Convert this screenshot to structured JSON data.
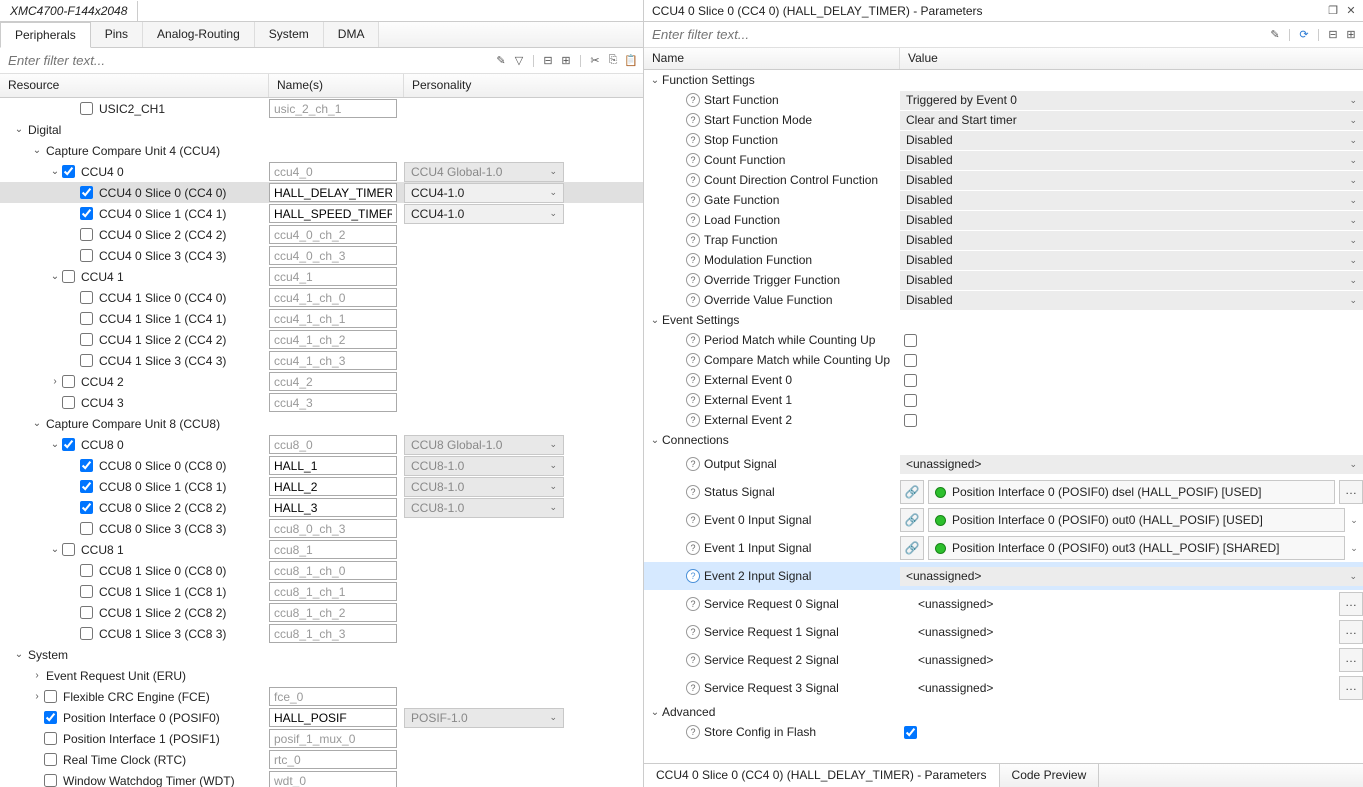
{
  "left": {
    "title_tab": "XMC4700-F144x2048",
    "subtabs": [
      "Peripherals",
      "Pins",
      "Analog-Routing",
      "System",
      "DMA"
    ],
    "active_subtab": 0,
    "filter_placeholder": "Enter filter text...",
    "headers": {
      "resource": "Resource",
      "names": "Name(s)",
      "personality": "Personality"
    },
    "tree": [
      {
        "indent": 3,
        "twisty": "",
        "chk": false,
        "label": "USIC2_CH1",
        "name": "usic_2_ch_1",
        "name_disabled": true,
        "pers": ""
      },
      {
        "indent": 0,
        "twisty": "open",
        "chk": null,
        "label": "Digital"
      },
      {
        "indent": 1,
        "twisty": "open",
        "chk": null,
        "label": "Capture Compare Unit 4 (CCU4)"
      },
      {
        "indent": 2,
        "twisty": "open",
        "chk": true,
        "label": "CCU4 0",
        "name": "ccu4_0",
        "name_disabled": true,
        "pers": "CCU4 Global-1.0",
        "pers_disabled": true
      },
      {
        "indent": 3,
        "twisty": "",
        "chk": true,
        "label": "CCU4 0 Slice 0 (CC4 0)",
        "name": "HALL_DELAY_TIMER",
        "pers": "CCU4-1.0",
        "selected": true
      },
      {
        "indent": 3,
        "twisty": "",
        "chk": true,
        "label": "CCU4 0 Slice 1 (CC4 1)",
        "name": "HALL_SPEED_TIMER",
        "pers": "CCU4-1.0"
      },
      {
        "indent": 3,
        "twisty": "",
        "chk": false,
        "label": "CCU4 0 Slice 2 (CC4 2)",
        "name": "ccu4_0_ch_2",
        "name_disabled": true
      },
      {
        "indent": 3,
        "twisty": "",
        "chk": false,
        "label": "CCU4 0 Slice 3 (CC4 3)",
        "name": "ccu4_0_ch_3",
        "name_disabled": true
      },
      {
        "indent": 2,
        "twisty": "open",
        "chk": false,
        "label": "CCU4 1",
        "name": "ccu4_1",
        "name_disabled": true
      },
      {
        "indent": 3,
        "twisty": "",
        "chk": false,
        "label": "CCU4 1 Slice 0 (CC4 0)",
        "name": "ccu4_1_ch_0",
        "name_disabled": true
      },
      {
        "indent": 3,
        "twisty": "",
        "chk": false,
        "label": "CCU4 1 Slice 1 (CC4 1)",
        "name": "ccu4_1_ch_1",
        "name_disabled": true
      },
      {
        "indent": 3,
        "twisty": "",
        "chk": false,
        "label": "CCU4 1 Slice 2 (CC4 2)",
        "name": "ccu4_1_ch_2",
        "name_disabled": true
      },
      {
        "indent": 3,
        "twisty": "",
        "chk": false,
        "label": "CCU4 1 Slice 3 (CC4 3)",
        "name": "ccu4_1_ch_3",
        "name_disabled": true
      },
      {
        "indent": 2,
        "twisty": "closed",
        "chk": false,
        "label": "CCU4 2",
        "name": "ccu4_2",
        "name_disabled": true
      },
      {
        "indent": 2,
        "twisty": "",
        "chk": false,
        "label": "CCU4 3",
        "name": "ccu4_3",
        "name_disabled": true
      },
      {
        "indent": 1,
        "twisty": "open",
        "chk": null,
        "label": "Capture Compare Unit 8 (CCU8)"
      },
      {
        "indent": 2,
        "twisty": "open",
        "chk": true,
        "label": "CCU8 0",
        "name": "ccu8_0",
        "name_disabled": true,
        "pers": "CCU8 Global-1.0",
        "pers_disabled": true
      },
      {
        "indent": 3,
        "twisty": "",
        "chk": true,
        "label": "CCU8 0 Slice 0 (CC8 0)",
        "name": "HALL_1",
        "pers": "CCU8-1.0",
        "pers_disabled": true
      },
      {
        "indent": 3,
        "twisty": "",
        "chk": true,
        "label": "CCU8 0 Slice 1 (CC8 1)",
        "name": "HALL_2",
        "pers": "CCU8-1.0",
        "pers_disabled": true
      },
      {
        "indent": 3,
        "twisty": "",
        "chk": true,
        "label": "CCU8 0 Slice 2 (CC8 2)",
        "name": "HALL_3",
        "pers": "CCU8-1.0",
        "pers_disabled": true
      },
      {
        "indent": 3,
        "twisty": "",
        "chk": false,
        "label": "CCU8 0 Slice 3 (CC8 3)",
        "name": "ccu8_0_ch_3",
        "name_disabled": true
      },
      {
        "indent": 2,
        "twisty": "open",
        "chk": false,
        "label": "CCU8 1",
        "name": "ccu8_1",
        "name_disabled": true
      },
      {
        "indent": 3,
        "twisty": "",
        "chk": false,
        "label": "CCU8 1 Slice 0 (CC8 0)",
        "name": "ccu8_1_ch_0",
        "name_disabled": true
      },
      {
        "indent": 3,
        "twisty": "",
        "chk": false,
        "label": "CCU8 1 Slice 1 (CC8 1)",
        "name": "ccu8_1_ch_1",
        "name_disabled": true
      },
      {
        "indent": 3,
        "twisty": "",
        "chk": false,
        "label": "CCU8 1 Slice 2 (CC8 2)",
        "name": "ccu8_1_ch_2",
        "name_disabled": true
      },
      {
        "indent": 3,
        "twisty": "",
        "chk": false,
        "label": "CCU8 1 Slice 3 (CC8 3)",
        "name": "ccu8_1_ch_3",
        "name_disabled": true
      },
      {
        "indent": 0,
        "twisty": "open",
        "chk": null,
        "label": "System"
      },
      {
        "indent": 1,
        "twisty": "closed",
        "chk": null,
        "label": "Event Request Unit (ERU)"
      },
      {
        "indent": 1,
        "twisty": "closed",
        "chk": false,
        "label": "Flexible CRC Engine (FCE)",
        "name": "fce_0",
        "name_disabled": true
      },
      {
        "indent": 1,
        "twisty": "",
        "chk": true,
        "label": "Position Interface 0 (POSIF0)",
        "name": "HALL_POSIF",
        "pers": "POSIF-1.0",
        "pers_disabled": true
      },
      {
        "indent": 1,
        "twisty": "",
        "chk": false,
        "label": "Position Interface 1 (POSIF1)",
        "name": "posif_1_mux_0",
        "name_disabled": true
      },
      {
        "indent": 1,
        "twisty": "",
        "chk": false,
        "label": "Real Time Clock (RTC)",
        "name": "rtc_0",
        "name_disabled": true
      },
      {
        "indent": 1,
        "twisty": "",
        "chk": false,
        "label": "Window Watchdog Timer (WDT)",
        "name": "wdt_0",
        "name_disabled": true
      }
    ]
  },
  "right": {
    "title": "CCU4 0 Slice 0 (CC4 0) (HALL_DELAY_TIMER) - Parameters",
    "filter_placeholder": "Enter filter text...",
    "headers": {
      "name": "Name",
      "value": "Value"
    },
    "groups": [
      {
        "label": "Function Settings",
        "rows": [
          {
            "name": "Start Function",
            "type": "dropdown",
            "value": "Triggered by Event 0"
          },
          {
            "name": "Start Function Mode",
            "type": "dropdown",
            "value": "Clear and Start timer"
          },
          {
            "name": "Stop Function",
            "type": "dropdown",
            "value": "Disabled"
          },
          {
            "name": "Count Function",
            "type": "dropdown",
            "value": "Disabled"
          },
          {
            "name": "Count Direction Control Function",
            "type": "dropdown",
            "value": "Disabled"
          },
          {
            "name": "Gate Function",
            "type": "dropdown",
            "value": "Disabled"
          },
          {
            "name": "Load Function",
            "type": "dropdown",
            "value": "Disabled"
          },
          {
            "name": "Trap Function",
            "type": "dropdown",
            "value": "Disabled"
          },
          {
            "name": "Modulation Function",
            "type": "dropdown",
            "value": "Disabled"
          },
          {
            "name": "Override Trigger Function",
            "type": "dropdown",
            "value": "Disabled"
          },
          {
            "name": "Override Value Function",
            "type": "dropdown",
            "value": "Disabled"
          }
        ]
      },
      {
        "label": "Event Settings",
        "rows": [
          {
            "name": "Period Match while Counting Up",
            "type": "checkbox",
            "checked": false
          },
          {
            "name": "Compare Match while Counting Up",
            "type": "checkbox",
            "checked": false
          },
          {
            "name": "External Event 0",
            "type": "checkbox",
            "checked": false
          },
          {
            "name": "External Event 1",
            "type": "checkbox",
            "checked": false
          },
          {
            "name": "External Event 2",
            "type": "checkbox",
            "checked": false
          }
        ]
      },
      {
        "label": "Connections",
        "rows": [
          {
            "name": "Output Signal",
            "type": "sigdrop",
            "value": "<unassigned>"
          },
          {
            "name": "Status Signal",
            "type": "siglink",
            "value": "Position Interface 0 (POSIF0) dsel (HALL_POSIF) [USED]",
            "ellipsis": true
          },
          {
            "name": "Event 0 Input Signal",
            "type": "siglink",
            "value": "Position Interface 0 (POSIF0) out0 (HALL_POSIF) [USED]",
            "dd": true
          },
          {
            "name": "Event 1 Input Signal",
            "type": "siglink",
            "value": "Position Interface 0 (POSIF0) out3 (HALL_POSIF) [SHARED]",
            "dd": true
          },
          {
            "name": "Event 2 Input Signal",
            "type": "sigdrop",
            "value": "<unassigned>",
            "selected": true
          },
          {
            "name": "Service Request 0 Signal",
            "type": "sigplain",
            "value": "<unassigned>",
            "ellipsis": true
          },
          {
            "name": "Service Request 1 Signal",
            "type": "sigplain",
            "value": "<unassigned>",
            "ellipsis": true
          },
          {
            "name": "Service Request 2 Signal",
            "type": "sigplain",
            "value": "<unassigned>",
            "ellipsis": true
          },
          {
            "name": "Service Request 3 Signal",
            "type": "sigplain",
            "value": "<unassigned>",
            "ellipsis": true
          }
        ]
      },
      {
        "label": "Advanced",
        "rows": [
          {
            "name": "Store Config in Flash",
            "type": "checkbox",
            "checked": true
          }
        ]
      }
    ],
    "bottom_tabs": [
      "CCU4 0 Slice 0 (CC4 0) (HALL_DELAY_TIMER) - Parameters",
      "Code Preview"
    ],
    "active_bottom": 0
  }
}
